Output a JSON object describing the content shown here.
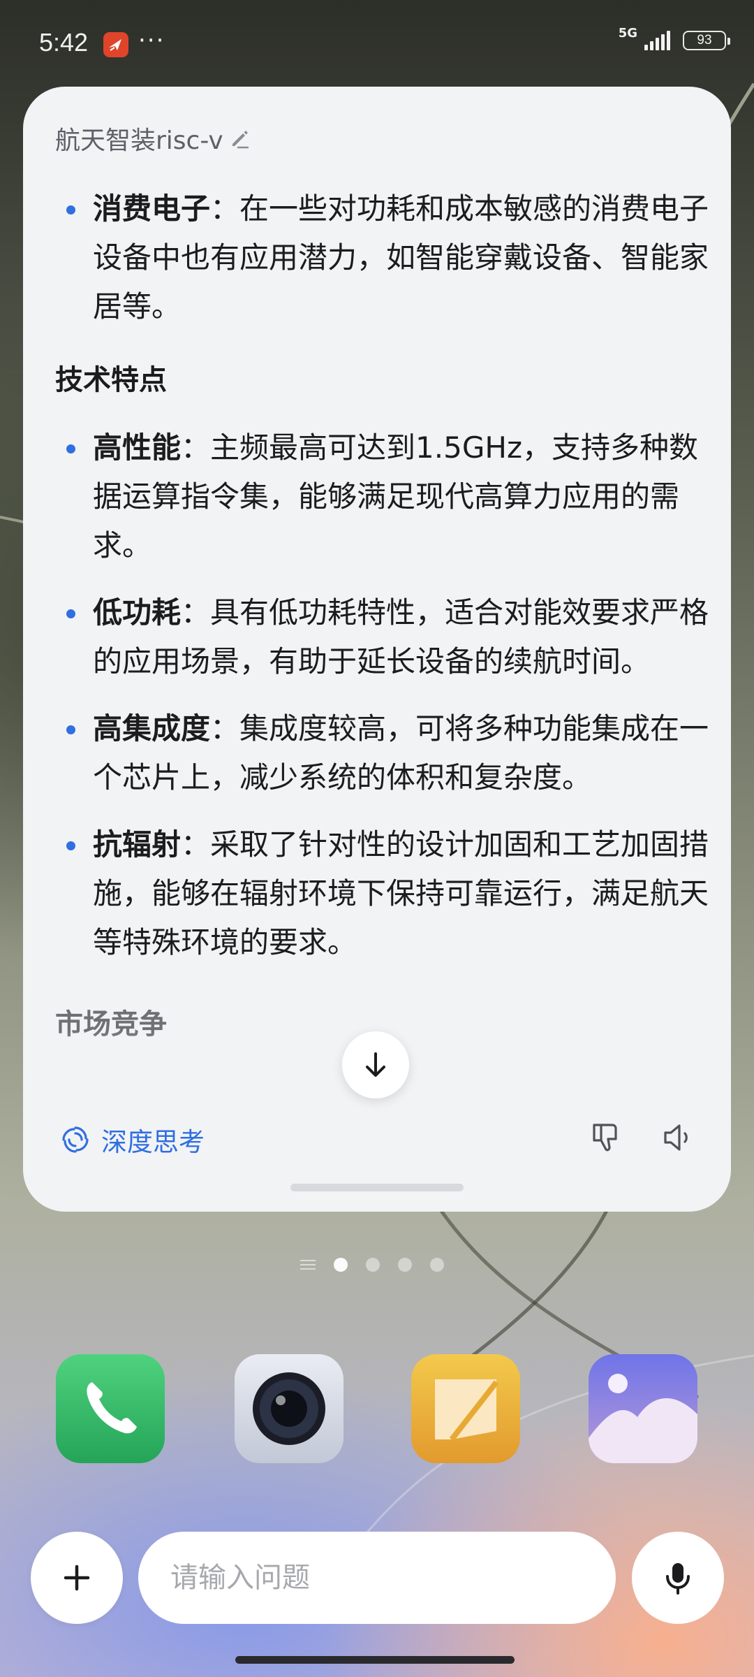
{
  "status_bar": {
    "time": "5:42",
    "more": "···",
    "network": "5G",
    "battery": "93",
    "icons": [
      "app-notification-icon",
      "signal-icon",
      "battery-icon"
    ]
  },
  "chat": {
    "title": "航天智装risc-v",
    "intro_bullet": {
      "term": "消费电子",
      "sep": "：",
      "text": "在一些对功耗和成本敏感的消费电子设备中也有应用潜力，如智能穿戴设备、智能家居等。"
    },
    "section_heading": "技术特点",
    "features": [
      {
        "term": "高性能",
        "sep": "：",
        "text": "主频最高可达到1.5GHz，支持多种数据运算指令集，能够满足现代高算力应用的需求。"
      },
      {
        "term": "低功耗",
        "sep": "：",
        "text": "具有低功耗特性，适合对能效要求严格的应用场景，有助于延长设备的续航时间。"
      },
      {
        "term": "高集成度",
        "sep": "：",
        "text": "集成度较高，可将多种功能集成在一个芯片上，减少系统的体积和复杂度。"
      },
      {
        "term": "抗辐射",
        "sep": "：",
        "text": "采取了针对性的设计加固和工艺加固措施，能够在辐射环境下保持可靠运行，满足航天等特殊环境的要求。"
      }
    ],
    "next_heading": "市场竞争",
    "deep_think_label": "深度思考",
    "icons": [
      "edit-icon",
      "scroll-down-icon",
      "deep-think-icon",
      "dislike-icon",
      "speaker-icon"
    ]
  },
  "home": {
    "active_page": 1,
    "page_count": 4,
    "dock_apps": [
      "phone",
      "camera",
      "notes",
      "gallery"
    ]
  },
  "input_bar": {
    "placeholder": "请输入问题",
    "value": ""
  },
  "colors": {
    "accent": "#2f6fe0",
    "card_bg": "#f2f3f5",
    "phone": "#34c26a",
    "notes": "#e9b23a",
    "gallery": "#8a7ce8"
  }
}
